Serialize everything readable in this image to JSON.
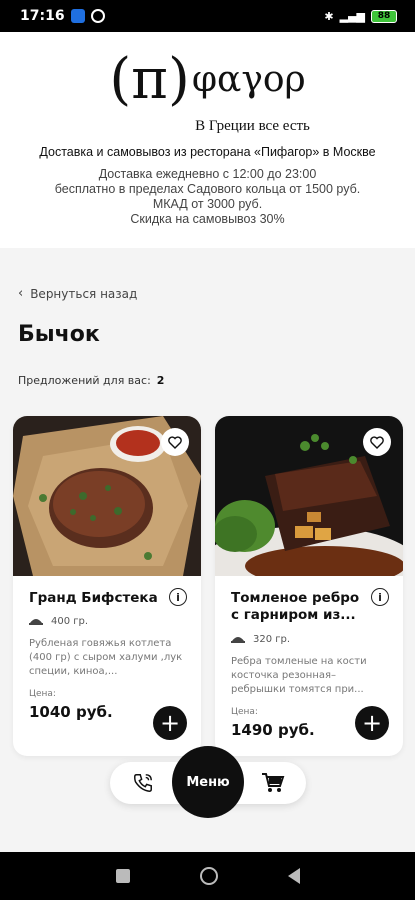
{
  "status": {
    "time": "17:16",
    "battery": "88"
  },
  "header": {
    "logo_pi": "(π)",
    "logo_word": "φαγορ",
    "tagline": "В Греции все есть",
    "title": "Доставка и самовывоз из ресторана «Пифагор» в Москве",
    "info_lines": [
      "Доставка ежедневно с 12:00 до 23:00",
      "бесплатно в пределах Садового кольца от 1500 руб.",
      "МКАД от 3000 руб.",
      "Скидка на самовывоз 30%"
    ]
  },
  "nav": {
    "back_label": "Вернуться назад"
  },
  "page": {
    "title": "Бычок",
    "offers_label": "Предложений для вас:",
    "offers_count": "2"
  },
  "products": [
    {
      "name": "Гранд Бифстека",
      "weight": "400 гр.",
      "description": "Рубленая говяжья котлета (400 гр) с сыром халуми ,лук специи, киноа,...",
      "price_label": "Цена:",
      "price": "1040 руб."
    },
    {
      "name": "Томленое ребро с гарниром из...",
      "weight": "320 гр.",
      "description": "Ребра томленые на кости косточка резонная– ребрышки томятся при...",
      "price_label": "Цена:",
      "price": "1490 руб."
    }
  ],
  "bottom": {
    "menu_label": "Меню"
  },
  "colors": {
    "accent": "#111111",
    "background": "#f4f4f4",
    "card": "#ffffff"
  }
}
